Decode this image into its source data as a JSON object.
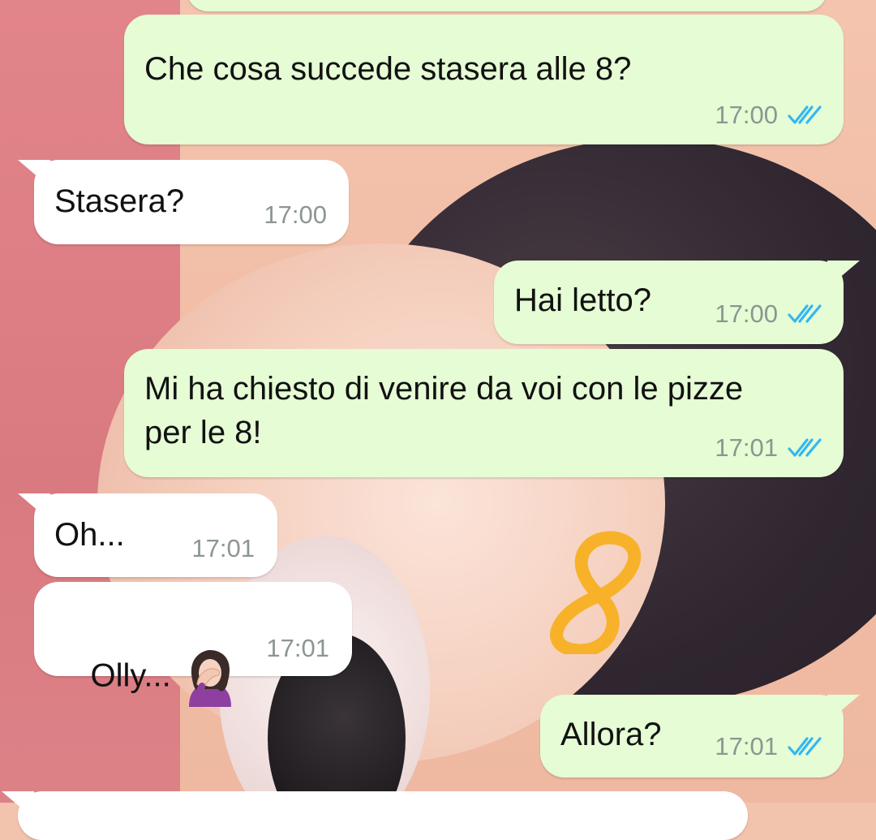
{
  "messages": [
    {
      "direction": "outgoing",
      "text": "",
      "time": "",
      "status_icon": "double-check-icon"
    },
    {
      "direction": "outgoing",
      "text": "Che cosa succede stasera alle 8?",
      "time": "17:00",
      "status_icon": "double-check-icon"
    },
    {
      "direction": "incoming",
      "text": "Stasera?",
      "time": "17:00"
    },
    {
      "direction": "outgoing",
      "text": "Hai letto?",
      "time": "17:00",
      "status_icon": "double-check-icon"
    },
    {
      "direction": "outgoing",
      "text": "Mi ha chiesto di venire da voi con le pizze per le 8!",
      "time": "17:01",
      "status_icon": "double-check-icon"
    },
    {
      "direction": "incoming",
      "text": "Oh...",
      "time": "17:01"
    },
    {
      "direction": "incoming",
      "text": "Olly...",
      "emoji": "woman-facepalming-icon",
      "time": "17:01"
    },
    {
      "direction": "outgoing",
      "text": "Allora?",
      "time": "17:01",
      "status_icon": "double-check-icon"
    },
    {
      "direction": "incoming",
      "text": "",
      "time": ""
    }
  ],
  "annotation": {
    "text": "8",
    "color": "#f7b22a"
  },
  "colors": {
    "outgoing_bubble": "#e5fcd5",
    "incoming_bubble": "#ffffff",
    "read_ticks": "#34b7f1",
    "timestamp": "#8c9691"
  }
}
